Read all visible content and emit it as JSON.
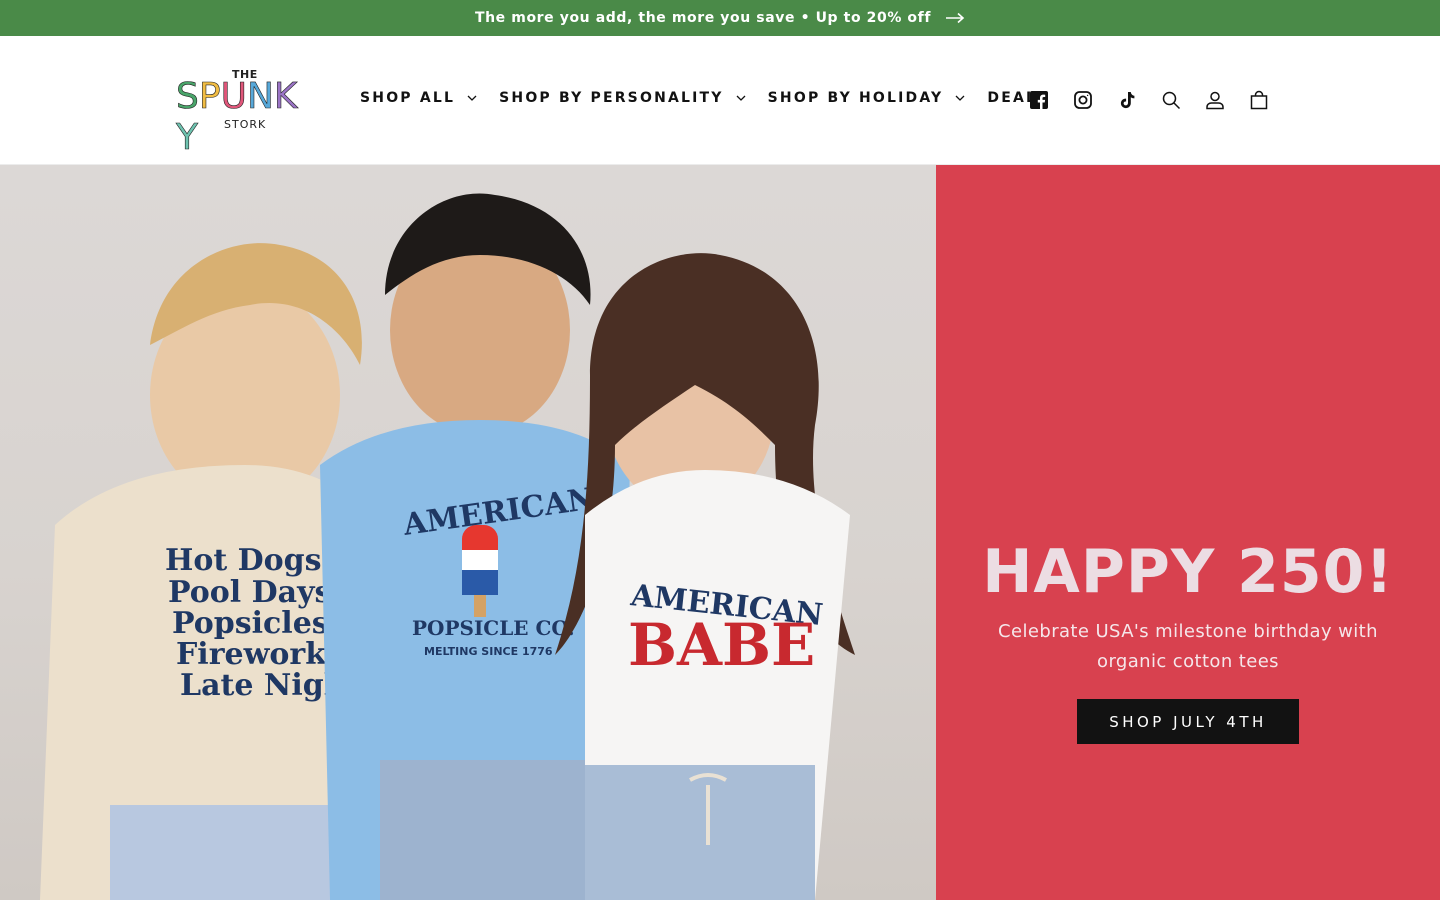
{
  "announcement": {
    "text": "The more you add, the more you save • Up to 20% off",
    "icon": "arrow-right-icon"
  },
  "logo": {
    "top": "THE",
    "letters": [
      "S",
      "P",
      "U",
      "N",
      "K",
      "Y"
    ],
    "bottom": "STORK"
  },
  "nav": {
    "items": [
      {
        "label": "SHOP ALL",
        "dropdown": true
      },
      {
        "label": "SHOP BY PERSONALITY",
        "dropdown": true
      },
      {
        "label": "SHOP BY HOLIDAY",
        "dropdown": true
      },
      {
        "label": "DEALS",
        "dropdown": false
      }
    ]
  },
  "header_icons": [
    "facebook-icon",
    "instagram-icon",
    "tiktok-icon",
    "search-icon",
    "account-icon",
    "cart-icon"
  ],
  "hero": {
    "title": "HAPPY 250!",
    "subtitle": "Celebrate USA's milestone birthday with organic cotton tees",
    "cta": "SHOP JULY 4TH",
    "shirts": {
      "left": [
        "Hot Dogs",
        "Pool Days",
        "Popsicles",
        "Fireworks",
        "Late Nights"
      ],
      "middle_top": "AMERICAN",
      "middle_main": "POPSICLE CO.",
      "middle_sub": "MELTING SINCE 1776",
      "right_top": "AMERICAN",
      "right_main": "BABE"
    }
  },
  "colors": {
    "announcement_bg": "#4a8a48",
    "hero_panel_bg": "#d8414f",
    "cta_bg": "#121212",
    "logo_letters": [
      "#4aa56a",
      "#f1bd44",
      "#e0567a",
      "#57a8d9",
      "#9b74c6",
      "#6fc3b0"
    ]
  }
}
